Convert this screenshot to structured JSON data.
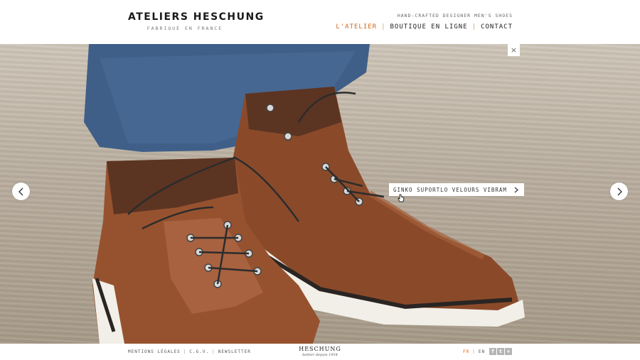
{
  "header": {
    "logo_title": "ATELIERS HESCHUNG",
    "logo_subtitle": "FABRIQUÉ EN FRANCE",
    "tagline": "HAND-CRAFTED DESIGNER MEN'S SHOES",
    "nav": [
      {
        "label": "L'ATELIER",
        "active": true
      },
      {
        "label": "BOUTIQUE EN LIGNE",
        "active": false
      },
      {
        "label": "CONTACT",
        "active": false
      }
    ]
  },
  "hero": {
    "close_label": "×",
    "product_tag": "GINKO SUPORTLO VELOURS VIBRAM"
  },
  "footer": {
    "links": [
      "MENTIONS LÉGALES",
      "C.G.V.",
      "NEWSLETTER"
    ],
    "logo_title": "HESCHUNG",
    "logo_subtitle": "bottier depuis 1934",
    "lang_active": "FR",
    "lang_other": "EN",
    "social": [
      "f",
      "t",
      "+"
    ]
  },
  "colors": {
    "accent": "#d2691e",
    "social_bg": "#b5b5b5"
  }
}
